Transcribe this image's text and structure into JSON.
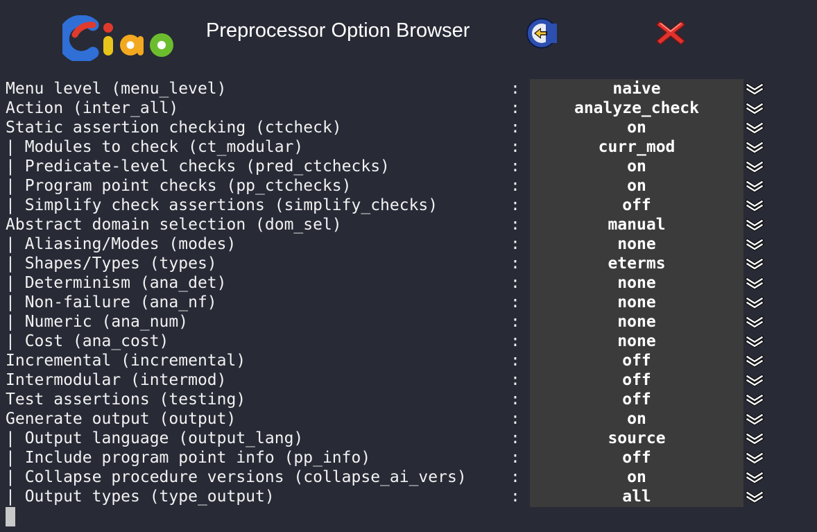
{
  "window": {
    "title": "Preprocessor Option Browser",
    "logo_icon": "ciao-logo",
    "back_icon": "ciao-back-icon",
    "close_icon": "close-icon"
  },
  "colors": {
    "background": "#282a36",
    "value_panel": "#3b3b3b",
    "close_red": "#e0332d"
  },
  "options": [
    {
      "label": "Menu level (menu_level)",
      "value": "naive"
    },
    {
      "label": "Action (inter_all)",
      "value": "analyze_check"
    },
    {
      "label": "Static assertion checking (ctcheck)",
      "value": "on"
    },
    {
      "label": "| Modules to check (ct_modular)",
      "value": "curr_mod"
    },
    {
      "label": "| Predicate-level checks (pred_ctchecks)",
      "value": "on"
    },
    {
      "label": "| Program point checks (pp_ctchecks)",
      "value": "on"
    },
    {
      "label": "| Simplify check assertions (simplify_checks)",
      "value": "off"
    },
    {
      "label": "Abstract domain selection (dom_sel)",
      "value": "manual"
    },
    {
      "label": "| Aliasing/Modes (modes)",
      "value": "none"
    },
    {
      "label": "| Shapes/Types (types)",
      "value": "eterms"
    },
    {
      "label": "| Determinism (ana_det)",
      "value": "none"
    },
    {
      "label": "| Non-failure (ana_nf)",
      "value": "none"
    },
    {
      "label": "| Numeric (ana_num)",
      "value": "none"
    },
    {
      "label": "| Cost (ana_cost)",
      "value": "none"
    },
    {
      "label": "Incremental (incremental)",
      "value": "off"
    },
    {
      "label": "Intermodular (intermod)",
      "value": "off"
    },
    {
      "label": "Test assertions (testing)",
      "value": "off"
    },
    {
      "label": "Generate output (output)",
      "value": "on"
    },
    {
      "label": "| Output language (output_lang)",
      "value": "source"
    },
    {
      "label": "| Include program point info (pp_info)",
      "value": "off"
    },
    {
      "label": "| Collapse procedure versions (collapse_ai_vers)",
      "value": "on"
    },
    {
      "label": "| Output types (type_output)",
      "value": "all"
    }
  ],
  "separator": ":",
  "dropdown_icon": "double-chevron-down-icon"
}
